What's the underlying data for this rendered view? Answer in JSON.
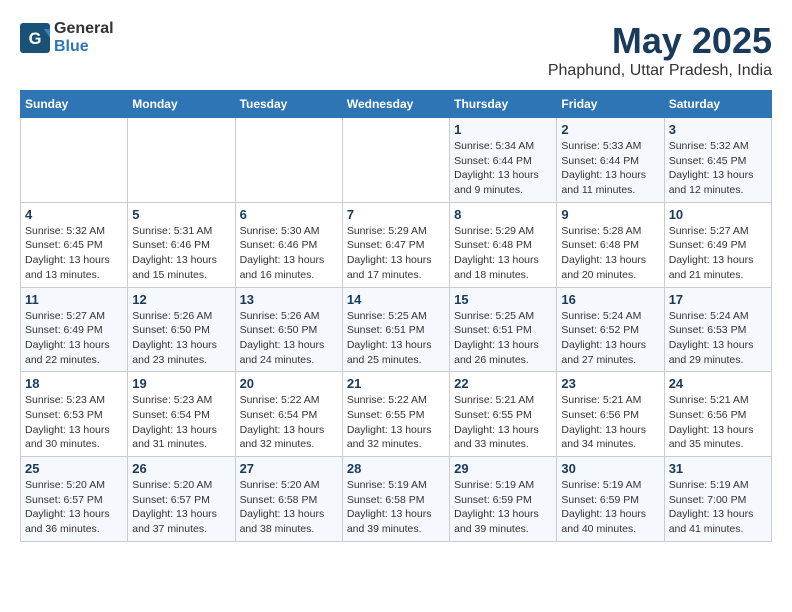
{
  "logo": {
    "general": "General",
    "blue": "Blue"
  },
  "title": {
    "month": "May 2025",
    "location": "Phaphund, Uttar Pradesh, India"
  },
  "headers": [
    "Sunday",
    "Monday",
    "Tuesday",
    "Wednesday",
    "Thursday",
    "Friday",
    "Saturday"
  ],
  "weeks": [
    [
      {
        "day": "",
        "info": ""
      },
      {
        "day": "",
        "info": ""
      },
      {
        "day": "",
        "info": ""
      },
      {
        "day": "",
        "info": ""
      },
      {
        "day": "1",
        "info": "Sunrise: 5:34 AM\nSunset: 6:44 PM\nDaylight: 13 hours\nand 9 minutes."
      },
      {
        "day": "2",
        "info": "Sunrise: 5:33 AM\nSunset: 6:44 PM\nDaylight: 13 hours\nand 11 minutes."
      },
      {
        "day": "3",
        "info": "Sunrise: 5:32 AM\nSunset: 6:45 PM\nDaylight: 13 hours\nand 12 minutes."
      }
    ],
    [
      {
        "day": "4",
        "info": "Sunrise: 5:32 AM\nSunset: 6:45 PM\nDaylight: 13 hours\nand 13 minutes."
      },
      {
        "day": "5",
        "info": "Sunrise: 5:31 AM\nSunset: 6:46 PM\nDaylight: 13 hours\nand 15 minutes."
      },
      {
        "day": "6",
        "info": "Sunrise: 5:30 AM\nSunset: 6:46 PM\nDaylight: 13 hours\nand 16 minutes."
      },
      {
        "day": "7",
        "info": "Sunrise: 5:29 AM\nSunset: 6:47 PM\nDaylight: 13 hours\nand 17 minutes."
      },
      {
        "day": "8",
        "info": "Sunrise: 5:29 AM\nSunset: 6:48 PM\nDaylight: 13 hours\nand 18 minutes."
      },
      {
        "day": "9",
        "info": "Sunrise: 5:28 AM\nSunset: 6:48 PM\nDaylight: 13 hours\nand 20 minutes."
      },
      {
        "day": "10",
        "info": "Sunrise: 5:27 AM\nSunset: 6:49 PM\nDaylight: 13 hours\nand 21 minutes."
      }
    ],
    [
      {
        "day": "11",
        "info": "Sunrise: 5:27 AM\nSunset: 6:49 PM\nDaylight: 13 hours\nand 22 minutes."
      },
      {
        "day": "12",
        "info": "Sunrise: 5:26 AM\nSunset: 6:50 PM\nDaylight: 13 hours\nand 23 minutes."
      },
      {
        "day": "13",
        "info": "Sunrise: 5:26 AM\nSunset: 6:50 PM\nDaylight: 13 hours\nand 24 minutes."
      },
      {
        "day": "14",
        "info": "Sunrise: 5:25 AM\nSunset: 6:51 PM\nDaylight: 13 hours\nand 25 minutes."
      },
      {
        "day": "15",
        "info": "Sunrise: 5:25 AM\nSunset: 6:51 PM\nDaylight: 13 hours\nand 26 minutes."
      },
      {
        "day": "16",
        "info": "Sunrise: 5:24 AM\nSunset: 6:52 PM\nDaylight: 13 hours\nand 27 minutes."
      },
      {
        "day": "17",
        "info": "Sunrise: 5:24 AM\nSunset: 6:53 PM\nDaylight: 13 hours\nand 29 minutes."
      }
    ],
    [
      {
        "day": "18",
        "info": "Sunrise: 5:23 AM\nSunset: 6:53 PM\nDaylight: 13 hours\nand 30 minutes."
      },
      {
        "day": "19",
        "info": "Sunrise: 5:23 AM\nSunset: 6:54 PM\nDaylight: 13 hours\nand 31 minutes."
      },
      {
        "day": "20",
        "info": "Sunrise: 5:22 AM\nSunset: 6:54 PM\nDaylight: 13 hours\nand 32 minutes."
      },
      {
        "day": "21",
        "info": "Sunrise: 5:22 AM\nSunset: 6:55 PM\nDaylight: 13 hours\nand 32 minutes."
      },
      {
        "day": "22",
        "info": "Sunrise: 5:21 AM\nSunset: 6:55 PM\nDaylight: 13 hours\nand 33 minutes."
      },
      {
        "day": "23",
        "info": "Sunrise: 5:21 AM\nSunset: 6:56 PM\nDaylight: 13 hours\nand 34 minutes."
      },
      {
        "day": "24",
        "info": "Sunrise: 5:21 AM\nSunset: 6:56 PM\nDaylight: 13 hours\nand 35 minutes."
      }
    ],
    [
      {
        "day": "25",
        "info": "Sunrise: 5:20 AM\nSunset: 6:57 PM\nDaylight: 13 hours\nand 36 minutes."
      },
      {
        "day": "26",
        "info": "Sunrise: 5:20 AM\nSunset: 6:57 PM\nDaylight: 13 hours\nand 37 minutes."
      },
      {
        "day": "27",
        "info": "Sunrise: 5:20 AM\nSunset: 6:58 PM\nDaylight: 13 hours\nand 38 minutes."
      },
      {
        "day": "28",
        "info": "Sunrise: 5:19 AM\nSunset: 6:58 PM\nDaylight: 13 hours\nand 39 minutes."
      },
      {
        "day": "29",
        "info": "Sunrise: 5:19 AM\nSunset: 6:59 PM\nDaylight: 13 hours\nand 39 minutes."
      },
      {
        "day": "30",
        "info": "Sunrise: 5:19 AM\nSunset: 6:59 PM\nDaylight: 13 hours\nand 40 minutes."
      },
      {
        "day": "31",
        "info": "Sunrise: 5:19 AM\nSunset: 7:00 PM\nDaylight: 13 hours\nand 41 minutes."
      }
    ]
  ]
}
